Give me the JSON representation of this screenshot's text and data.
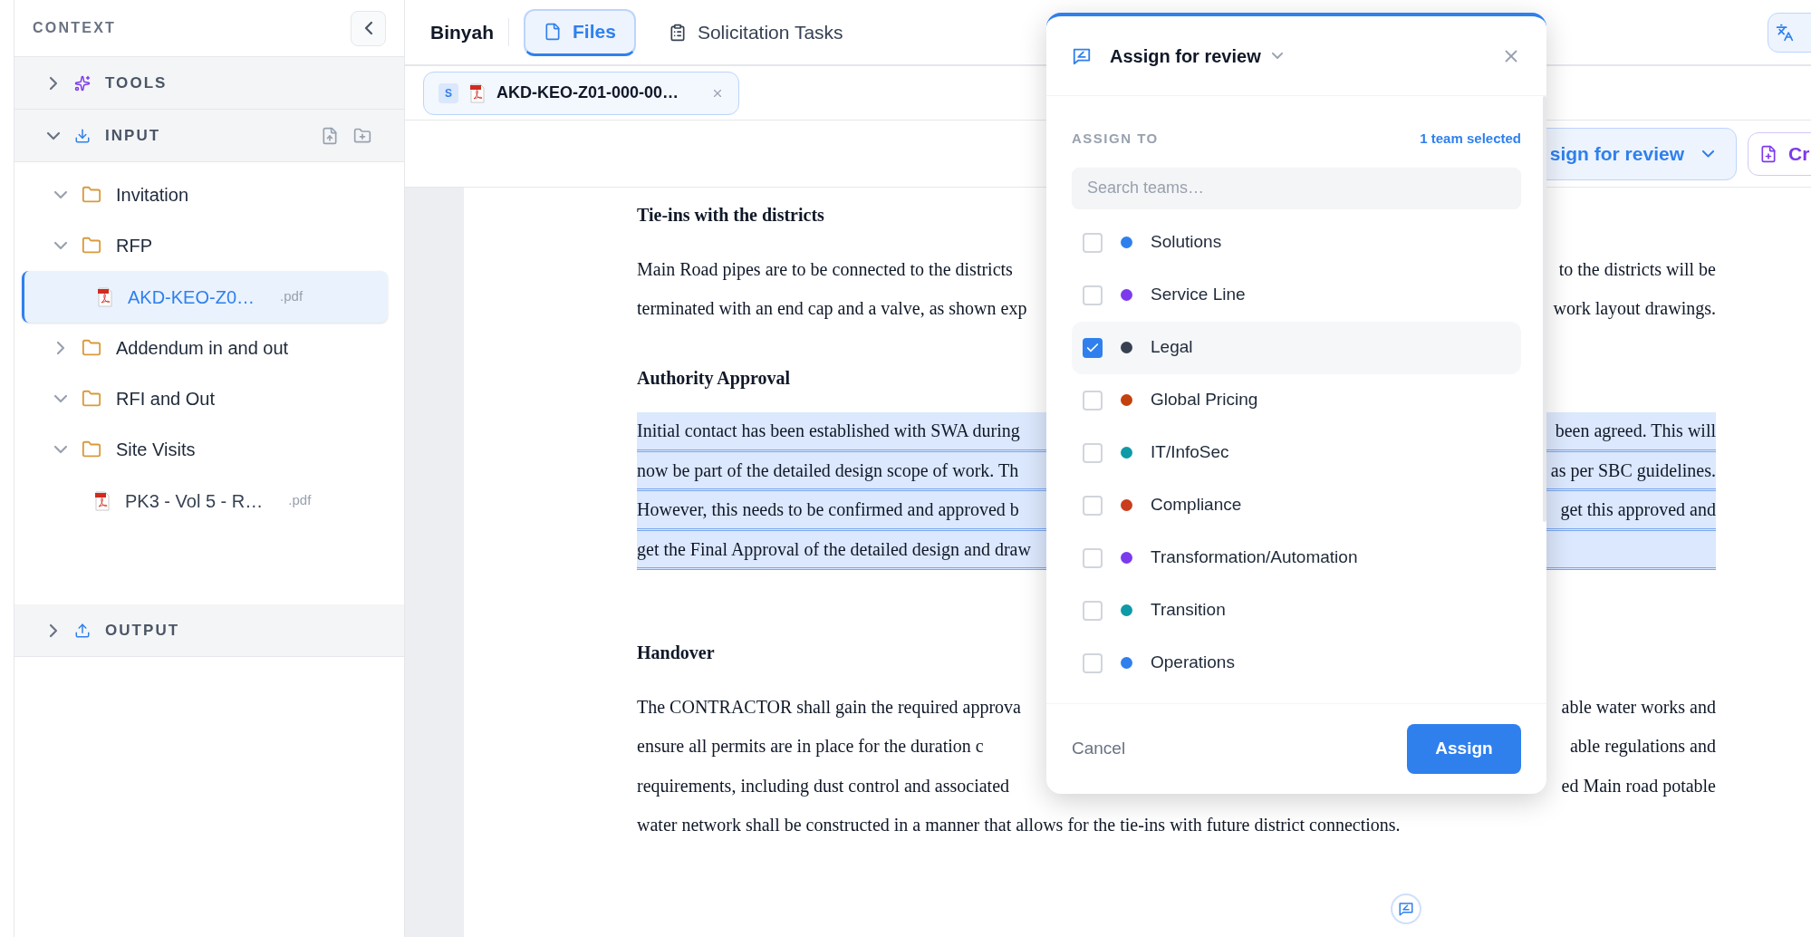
{
  "sidebar": {
    "title": "CONTEXT",
    "sections": [
      {
        "kind": "tools",
        "label": "TOOLS",
        "expanded": false
      },
      {
        "kind": "input",
        "label": "INPUT",
        "expanded": true,
        "items": [
          {
            "kind": "folder",
            "name": "Invitation",
            "expanded": true,
            "selected": false
          },
          {
            "kind": "folder",
            "name": "RFP",
            "expanded": true,
            "selected": false,
            "children": [
              {
                "kind": "file",
                "name": "AKD-KEO-Z0…",
                "ext": ".pdf",
                "selected": true
              }
            ]
          },
          {
            "kind": "folder",
            "name": "Addendum in and out",
            "expanded": false,
            "selected": false
          },
          {
            "kind": "folder",
            "name": "RFI and Out",
            "expanded": true,
            "selected": false
          },
          {
            "kind": "folder",
            "name": "Site Visits",
            "expanded": true,
            "selected": false,
            "children": [
              {
                "kind": "file",
                "name": "PK3 - Vol 5 - R…",
                "ext": ".pdf",
                "selected": false
              }
            ]
          }
        ]
      },
      {
        "kind": "output",
        "label": "OUTPUT",
        "expanded": false
      }
    ]
  },
  "header": {
    "brand": "Binyah",
    "tabs": [
      {
        "kind": "files",
        "label": "Files",
        "selected": true
      },
      {
        "kind": "tasks",
        "label": "Solicitation Tasks",
        "selected": false
      }
    ]
  },
  "open_file": {
    "badge": "S",
    "name": "AKD-KEO-Z01-000-00…",
    "selected": true
  },
  "toolbar": [
    {
      "kind": "assign",
      "label": "sign for review"
    },
    {
      "kind": "create",
      "label": "Cr"
    }
  ],
  "document": [
    {
      "kind": "heading",
      "text": "Tie-ins with the districts"
    },
    {
      "kind": "paragraph",
      "highlighted": false,
      "lines": [
        {
          "left": "Main Road pipes are to be connected to the districts",
          "right": "to the districts will be"
        },
        {
          "left": "terminated with an end cap and a valve, as shown exp",
          "right": "work layout drawings."
        }
      ]
    },
    {
      "kind": "heading",
      "text": "Authority Approval"
    },
    {
      "kind": "paragraph",
      "highlighted": true,
      "lines": [
        {
          "left": "Initial contact has been established with SWA during",
          "right": "been agreed. This will"
        },
        {
          "left": "now be part of the detailed design scope of work. Th",
          "right": "as per SBC guidelines."
        },
        {
          "left": "However, this needs to be confirmed and approved b",
          "right": "get this approved and"
        },
        {
          "left": "get the Final Approval of the detailed design and draw"
        }
      ]
    },
    {
      "kind": "heading",
      "text": "Handover"
    },
    {
      "kind": "paragraph",
      "highlighted": false,
      "lines": [
        {
          "left": "The CONTRACTOR shall gain the required approva",
          "right": "able water works and"
        },
        {
          "left": "ensure all permits are in place for the duration c",
          "right": "able regulations and"
        },
        {
          "left": "requirements, including dust control and associated",
          "right": "ed Main road potable"
        },
        {
          "left": "water network shall be constructed in a manner that allows for the tie-ins with future district connections."
        }
      ]
    }
  ],
  "dialog": {
    "title": "Assign for review",
    "section_label": "ASSIGN TO",
    "selection_count": "1 team selected",
    "search": {
      "placeholder": "Search teams…"
    },
    "teams": [
      {
        "name": "Solutions",
        "color": "#2f80ed",
        "checked": false
      },
      {
        "name": "Service Line",
        "color": "#7c3aed",
        "checked": false
      },
      {
        "name": "Legal",
        "color": "#374151",
        "checked": true
      },
      {
        "name": "Global Pricing",
        "color": "#c2410c",
        "checked": false
      },
      {
        "name": "IT/InfoSec",
        "color": "#0e9aa7",
        "checked": false
      },
      {
        "name": "Compliance",
        "color": "#c93c1d",
        "checked": false
      },
      {
        "name": "Transformation/Automation",
        "color": "#7c3aed",
        "checked": false
      },
      {
        "name": "Transition",
        "color": "#0e9aa7",
        "checked": false
      },
      {
        "name": "Operations",
        "color": "#2f80ed",
        "checked": false
      }
    ],
    "cancel": "Cancel",
    "submit": "Assign"
  }
}
